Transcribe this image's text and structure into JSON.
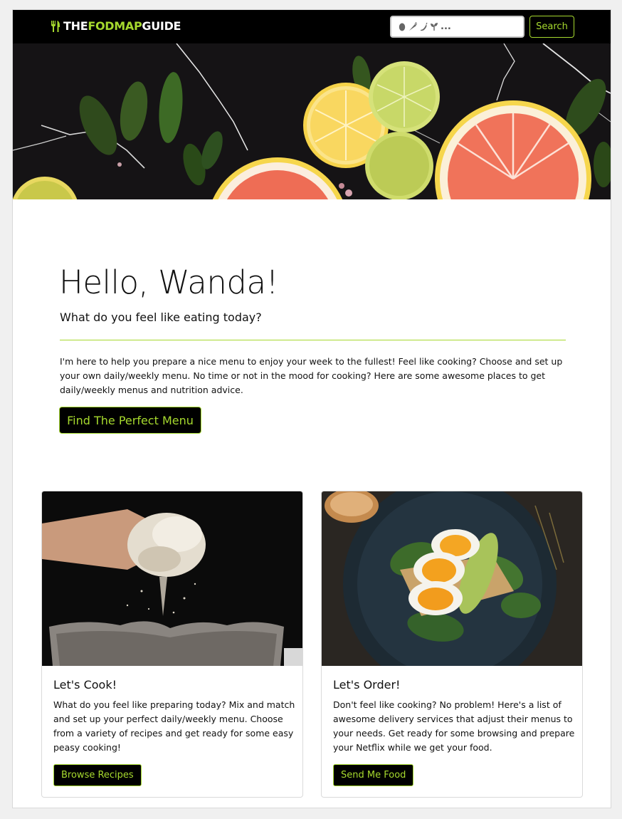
{
  "navbar": {
    "brand_part1": "THE",
    "brand_part2": "FODMAP",
    "brand_part3": "GUIDE",
    "search_placeholder_suffix": "...",
    "search_button": "Search"
  },
  "greeting": {
    "title": "Hello, Wanda!",
    "subtitle": "What do you feel like eating today?",
    "intro": "I'm here to help you prepare a nice menu to enjoy your week to the fullest! Feel like cooking? Choose and set up your own daily/weekly menu. No time or not in the mood for cooking? Here are some awesome places to get daily/weekly menus and nutrition advice.",
    "cta": "Find The Perfect Menu"
  },
  "cards": [
    {
      "title": "Let's Cook!",
      "text": "What do you feel like preparing today? Mix and match and set up your perfect daily/weekly menu. Choose from a variety of recipes and get ready for some easy peasy cooking!",
      "button": "Browse Recipes"
    },
    {
      "title": "Let's Order!",
      "text": "Don't feel like cooking? No problem! Here's a list of awesome delivery services that adjust their menus to your needs. Get ready for some browsing and prepare your Netflix while we get your food.",
      "button": "Send Me Food"
    }
  ],
  "colors": {
    "accent": "#a6d92e",
    "navbar_bg": "#000000"
  },
  "icons": [
    "fork-knife-icon",
    "egg-icon",
    "carrot-icon",
    "chili-icon",
    "sprout-icon"
  ]
}
